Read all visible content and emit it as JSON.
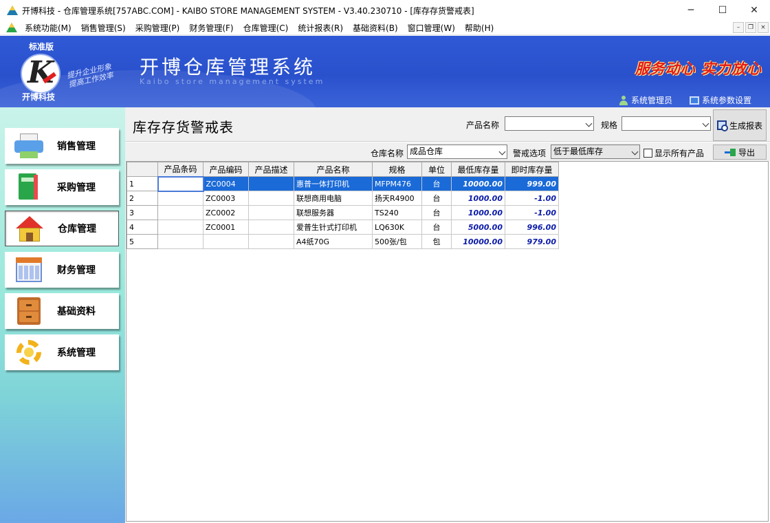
{
  "window": {
    "title": "开博科技 - 仓库管理系统[757ABC.COM] - KAIBO STORE MANAGEMENT SYSTEM - V3.40.230710 - [库存存货警戒表]",
    "minimize": "─",
    "maximize": "☐",
    "close": "✕"
  },
  "menu": {
    "items": [
      "系统功能(M)",
      "销售管理(S)",
      "采购管理(P)",
      "财务管理(F)",
      "仓库管理(C)",
      "统计报表(R)",
      "基础资料(B)",
      "窗口管理(W)",
      "帮助(H)"
    ],
    "mdi_min": "–",
    "mdi_restore": "❐",
    "mdi_close": "×"
  },
  "header": {
    "edition": "标准版",
    "logo_letter": "K",
    "company": "开博科技",
    "slogan_line1": "提升企业形象",
    "slogan_line2": "提高工作效率",
    "system_title": "开博仓库管理系统",
    "system_subtitle": "Kaibo store management system",
    "motto": "服务动心 实力放心",
    "user_label": "系统管理员",
    "settings_label": "系统参数设置"
  },
  "sidebar": {
    "items": [
      {
        "label": "销售管理",
        "icon": "printer-icon"
      },
      {
        "label": "采购管理",
        "icon": "book-icon"
      },
      {
        "label": "仓库管理",
        "icon": "home-icon"
      },
      {
        "label": "财务管理",
        "icon": "calendar-icon"
      },
      {
        "label": "基础资料",
        "icon": "cabinet-icon"
      },
      {
        "label": "系统管理",
        "icon": "gear-icon"
      }
    ],
    "active": "仓库管理"
  },
  "form": {
    "page_title": "库存存货警戒表",
    "product_name_label": "产品名称",
    "product_name_value": "",
    "spec_label": "规格",
    "spec_value": "",
    "generate_label": "生成报表",
    "warehouse_label": "仓库名称",
    "warehouse_value": "成品仓库",
    "alert_label": "警戒选项",
    "alert_value": "低于最低库存",
    "show_all_label": "显示所有产品",
    "show_all_checked": false,
    "export_label": "导出"
  },
  "table": {
    "columns": [
      "",
      "产品条码",
      "产品编码",
      "产品描述",
      "产品名称",
      "规格",
      "单位",
      "最低库存量",
      "即时库存量"
    ],
    "rows": [
      {
        "no": "1",
        "barcode": "",
        "code": "ZC0004",
        "desc": "",
        "name": "惠普一体打印机",
        "spec": "MFPM476",
        "unit": "台",
        "min": "10000.00",
        "current": "999.00"
      },
      {
        "no": "2",
        "barcode": "",
        "code": "ZC0003",
        "desc": "",
        "name": "联想商用电脑",
        "spec": "扬天R4900",
        "unit": "台",
        "min": "1000.00",
        "current": "-1.00"
      },
      {
        "no": "3",
        "barcode": "",
        "code": "ZC0002",
        "desc": "",
        "name": "联想服务器",
        "spec": "TS240",
        "unit": "台",
        "min": "1000.00",
        "current": "-1.00"
      },
      {
        "no": "4",
        "barcode": "",
        "code": "ZC0001",
        "desc": "",
        "name": "爱普生针式打印机",
        "spec": "LQ630K",
        "unit": "台",
        "min": "5000.00",
        "current": "996.00"
      },
      {
        "no": "5",
        "barcode": "",
        "code": "",
        "desc": "",
        "name": "A4纸70G",
        "spec": "500张/包",
        "unit": "包",
        "min": "10000.00",
        "current": "979.00"
      }
    ],
    "selected_row": 0
  },
  "colors": {
    "banner": "#2f59d6",
    "selection": "#1a6ad8",
    "numbers": "#0a1aa8",
    "motto": "#e21b1b"
  }
}
